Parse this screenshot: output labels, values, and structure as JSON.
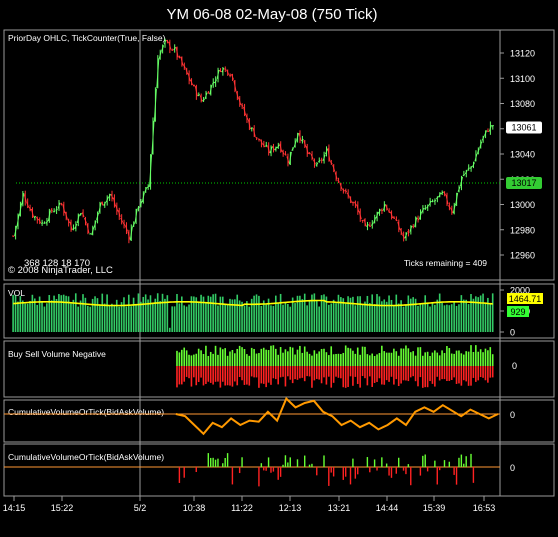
{
  "window_title": "YM 06-08  02-May-08 (750 Tick)",
  "copyright": "© 2008 NinjaTrader, LLC",
  "crosshair_readout": "368 128 18 170",
  "date_separator_label": "5/2",
  "time_labels": [
    "14:15",
    "15:22",
    "5/2",
    "10:38",
    "11:22",
    "12:13",
    "13:21",
    "14:44",
    "15:39",
    "16:53"
  ],
  "colors": {
    "up": "#66ff66",
    "down": "#ff3333",
    "volume_bar": "#33cc66",
    "volume_sma": "#ffff00",
    "buy_bar": "#66ff33",
    "sell_bar": "#ff2222",
    "cumulative_line": "#ff9900",
    "ref_line": "#ff9933",
    "prior_day_line": "#00cc00",
    "price_badge": "#ffffff",
    "prior_close_badge": "#33cc33",
    "sma_badge": "#ffff00",
    "last_vol_badge": "#33ff33"
  },
  "chart_data": [
    {
      "type": "candlestick",
      "title": "YM 06-08  02-May-08 (750 Tick)",
      "indicator_labels": [
        "PriorDay OHLC",
        "TickCounter(True, False)"
      ],
      "annotation": "Ticks remaining = 409",
      "ylim": [
        12950,
        13130
      ],
      "y_ticks": [
        12960,
        12980,
        13000,
        13020,
        13040,
        13060,
        13080,
        13100,
        13120
      ],
      "last_price": 13061,
      "prior_day_close": 13017,
      "prior_day_close_label": "13017",
      "last_price_label": "13061",
      "close_path": [
        [
          0,
          12975
        ],
        [
          4,
          13008
        ],
        [
          8,
          12992
        ],
        [
          12,
          12985
        ],
        [
          16,
          12995
        ],
        [
          20,
          13000
        ],
        [
          24,
          12980
        ],
        [
          28,
          12995
        ],
        [
          32,
          12975
        ],
        [
          36,
          13000
        ],
        [
          40,
          13008
        ],
        [
          44,
          12990
        ],
        [
          48,
          12975
        ],
        [
          52,
          13000
        ],
        [
          56,
          13015
        ],
        [
          60,
          13118
        ],
        [
          63,
          13128
        ],
        [
          67,
          13122
        ],
        [
          70,
          13110
        ],
        [
          74,
          13095
        ],
        [
          78,
          13082
        ],
        [
          82,
          13094
        ],
        [
          86,
          13108
        ],
        [
          90,
          13105
        ],
        [
          94,
          13080
        ],
        [
          98,
          13062
        ],
        [
          102,
          13050
        ],
        [
          106,
          13042
        ],
        [
          110,
          13048
        ],
        [
          114,
          13035
        ],
        [
          118,
          13058
        ],
        [
          122,
          13040
        ],
        [
          126,
          13030
        ],
        [
          130,
          13042
        ],
        [
          134,
          13022
        ],
        [
          138,
          13008
        ],
        [
          142,
          12998
        ],
        [
          146,
          12980
        ],
        [
          150,
          12990
        ],
        [
          154,
          13000
        ],
        [
          158,
          12988
        ],
        [
          162,
          12973
        ],
        [
          166,
          12985
        ],
        [
          170,
          12995
        ],
        [
          174,
          13002
        ],
        [
          178,
          13008
        ],
        [
          182,
          12995
        ],
        [
          186,
          13022
        ],
        [
          190,
          13030
        ],
        [
          194,
          13050
        ],
        [
          197,
          13060
        ],
        [
          199,
          13063
        ]
      ]
    },
    {
      "type": "bar",
      "title": "VOL",
      "ylim": [
        0,
        2000
      ],
      "y_ticks": [
        0,
        1000,
        2000
      ],
      "sma_value_label": "1464.71",
      "last_value_label": "929"
    },
    {
      "type": "bar",
      "title": "Buy Sell Volume Negative",
      "y_ticks": [
        0
      ]
    },
    {
      "type": "line",
      "title": "CumulativeVolumeOrTick(BidAskVolume)",
      "y_ticks": [
        0
      ],
      "path": [
        [
          0,
          0
        ],
        [
          4,
          -0.1
        ],
        [
          8,
          -0.5
        ],
        [
          12,
          -0.9
        ],
        [
          16,
          -0.4
        ],
        [
          20,
          -0.6
        ],
        [
          24,
          -0.2
        ],
        [
          28,
          -0.5
        ],
        [
          32,
          -0.3
        ],
        [
          36,
          -0.35
        ],
        [
          40,
          0.1
        ],
        [
          44,
          -0.3
        ],
        [
          48,
          0.7
        ],
        [
          52,
          0.3
        ],
        [
          56,
          0.5
        ],
        [
          60,
          0.6
        ],
        [
          64,
          0.1
        ],
        [
          68,
          -0.1
        ],
        [
          72,
          -0.5
        ],
        [
          76,
          -0.3
        ],
        [
          80,
          -0.6
        ],
        [
          84,
          -0.4
        ],
        [
          88,
          -0.7
        ],
        [
          92,
          -0.5
        ],
        [
          96,
          -0.2
        ],
        [
          100,
          -0.5
        ],
        [
          104,
          0.1
        ],
        [
          108,
          0.3
        ],
        [
          112,
          0.1
        ],
        [
          116,
          0.4
        ],
        [
          120,
          0.15
        ],
        [
          124,
          -0.1
        ],
        [
          128,
          0.2
        ],
        [
          132,
          0.0
        ],
        [
          136,
          -0.2
        ],
        [
          140,
          0.0
        ]
      ]
    },
    {
      "type": "bar",
      "title": "CumulativeVolumeOrTick(BidAskVolume)",
      "y_ticks": [
        0
      ]
    }
  ]
}
